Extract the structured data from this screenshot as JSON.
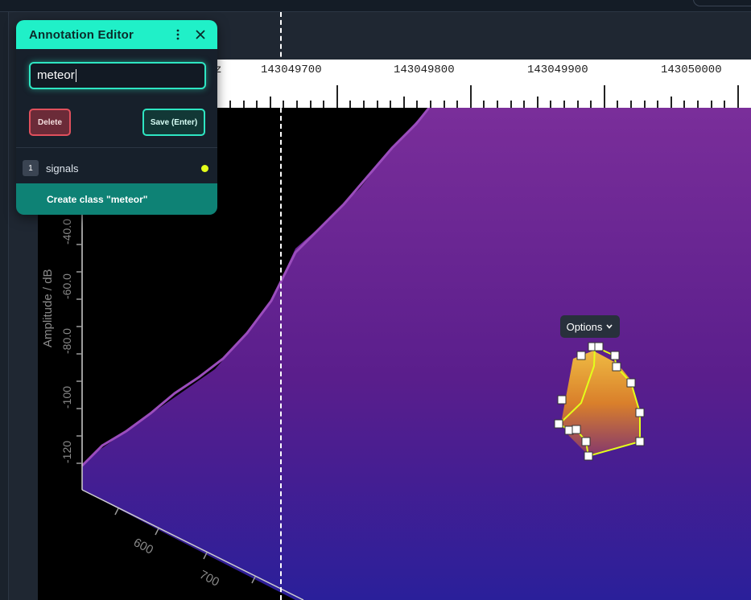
{
  "editor": {
    "title": "Annotation Editor",
    "menu_icon": "kebab-menu-icon",
    "close_icon": "close-icon",
    "input_value": "meteor",
    "delete_label": "Delete",
    "save_label": "Save (Enter)",
    "classes": [
      {
        "index": "1",
        "name": "signals",
        "color": "#e4ff1a"
      }
    ],
    "create_label": "Create class \"meteor\""
  },
  "ruler": {
    "partial_label": "z",
    "labels": [
      "143049700",
      "143049800",
      "143049900",
      "143050000"
    ]
  },
  "y_axis": {
    "label": "Amplitude / dB",
    "ticks": [
      "-40.0",
      "-60.0",
      "-80.0",
      "-100",
      "-120"
    ]
  },
  "z_axis": {
    "ticks": [
      "600",
      "700"
    ]
  },
  "options_label": "Options",
  "colors": {
    "accent": "#20f0c8",
    "annotation_outline": "#e4ff1a",
    "danger": "#e0505c"
  }
}
